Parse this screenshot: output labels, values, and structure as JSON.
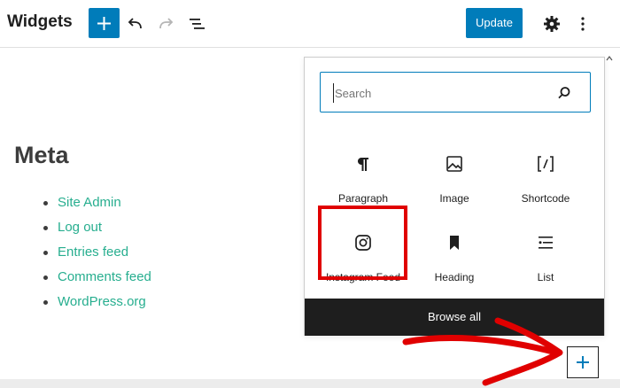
{
  "header": {
    "title": "Widgets",
    "update_label": "Update",
    "icons": [
      "plus-icon",
      "undo-icon",
      "redo-icon",
      "list-view-icon",
      "gear-icon",
      "more-vertical-icon"
    ]
  },
  "content": {
    "heading": "Meta",
    "links": [
      "Site Admin",
      "Log out",
      "Entries feed",
      "Comments feed",
      "WordPress.org"
    ]
  },
  "inserter": {
    "search_placeholder": "Search",
    "blocks": [
      {
        "label": "Paragraph",
        "icon": "paragraph-icon"
      },
      {
        "label": "Image",
        "icon": "image-icon"
      },
      {
        "label": "Shortcode",
        "icon": "shortcode-icon"
      },
      {
        "label": "Instagram Feed",
        "icon": "instagram-icon"
      },
      {
        "label": "Heading",
        "icon": "bookmark-icon"
      },
      {
        "label": "List",
        "icon": "list-icon"
      }
    ],
    "browse_all_label": "Browse all"
  },
  "colors": {
    "accent": "#007cba",
    "link": "#27ae8f",
    "highlight": "#e00000",
    "dark": "#1e1e1e"
  }
}
